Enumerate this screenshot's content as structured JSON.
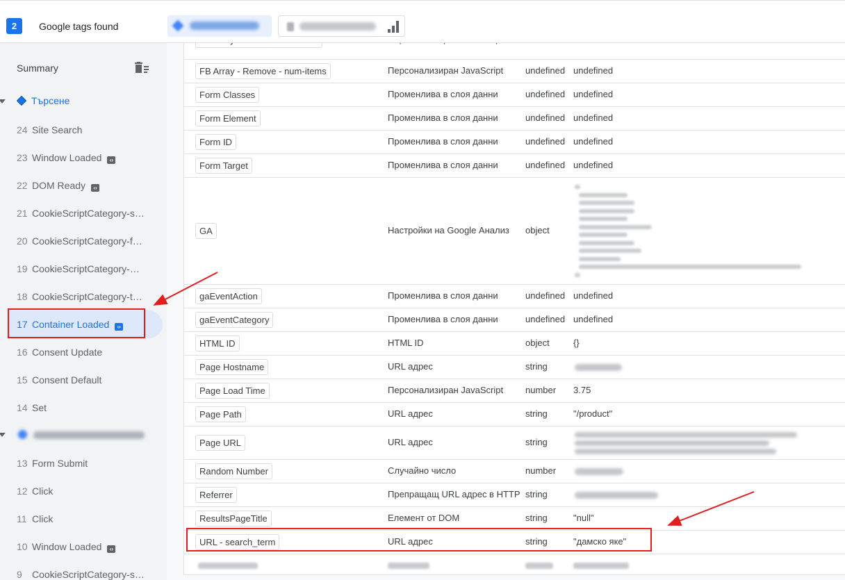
{
  "header": {
    "tag_count": "2",
    "tags_found_label": "Google tags found",
    "chip_gtm_icon": "gtm-diamond-icon",
    "chip_ga_icon": "analytics-bars-icon",
    "colors": {
      "accent": "#1a73e8",
      "analytics_orange": "#f9ab00",
      "analytics_dark": "#e37400",
      "highlight_red": "#e01e1e"
    }
  },
  "sidebar": {
    "summary_label": "Summary",
    "clear_icon": "clear-list-icon",
    "group_title": "Търсене",
    "events": [
      {
        "num": "24",
        "label": "Site Search",
        "icon": false
      },
      {
        "num": "23",
        "label": "Window Loaded",
        "icon": true
      },
      {
        "num": "22",
        "label": "DOM Ready",
        "icon": true
      },
      {
        "num": "21",
        "label": "CookieScriptCategory-s…",
        "icon": false
      },
      {
        "num": "20",
        "label": "CookieScriptCategory-f…",
        "icon": false
      },
      {
        "num": "19",
        "label": "CookieScriptCategory-…",
        "icon": false
      },
      {
        "num": "18",
        "label": "CookieScriptCategory-t…",
        "icon": false
      },
      {
        "num": "17",
        "label": "Container Loaded",
        "icon": true,
        "selected": true
      },
      {
        "num": "16",
        "label": "Consent Update",
        "icon": false
      },
      {
        "num": "15",
        "label": "Consent Default",
        "icon": false
      },
      {
        "num": "14",
        "label": "Set",
        "icon": false
      },
      {
        "num": "13",
        "label": "Form Submit",
        "icon": false
      },
      {
        "num": "12",
        "label": "Click",
        "icon": false
      },
      {
        "num": "11",
        "label": "Click",
        "icon": false
      },
      {
        "num": "10",
        "label": "Window Loaded",
        "icon": true
      },
      {
        "num": "9",
        "label": "CookieScriptCategory-s…",
        "icon": false
      }
    ]
  },
  "variables": [
    {
      "name": "FB Array - Remove - contents",
      "type": "Персонализиран JavaScript",
      "return_type": "undefined",
      "value": "undefined"
    },
    {
      "name": "FB Array - Remove - num-items",
      "type": "Персонализиран JavaScript",
      "return_type": "undefined",
      "value": "undefined"
    },
    {
      "name": "Form Classes",
      "type": "Променлива в слоя данни",
      "return_type": "undefined",
      "value": "undefined"
    },
    {
      "name": "Form Element",
      "type": "Променлива в слоя данни",
      "return_type": "undefined",
      "value": "undefined"
    },
    {
      "name": "Form ID",
      "type": "Променлива в слоя данни",
      "return_type": "undefined",
      "value": "undefined"
    },
    {
      "name": "Form Target",
      "type": "Променлива в слоя данни",
      "return_type": "undefined",
      "value": "undefined"
    },
    {
      "name": "GA",
      "type": "Настройки на Google Анализ",
      "return_type": "object",
      "value": ""
    },
    {
      "name": "gaEventAction",
      "type": "Променлива в слоя данни",
      "return_type": "undefined",
      "value": "undefined"
    },
    {
      "name": "gaEventCategory",
      "type": "Променлива в слоя данни",
      "return_type": "undefined",
      "value": "undefined"
    },
    {
      "name": "HTML ID",
      "type": "HTML ID",
      "return_type": "object",
      "value": "{}"
    },
    {
      "name": "Page Hostname",
      "type": "URL адрес",
      "return_type": "string",
      "value": ""
    },
    {
      "name": "Page Load Time",
      "type": "Персонализиран JavaScript",
      "return_type": "number",
      "value": "3.75"
    },
    {
      "name": "Page Path",
      "type": "URL адрес",
      "return_type": "string",
      "value": "\"/product\""
    },
    {
      "name": "Page URL",
      "type": "URL адрес",
      "return_type": "string",
      "value": ""
    },
    {
      "name": "Random Number",
      "type": "Случайно число",
      "return_type": "number",
      "value": ""
    },
    {
      "name": "Referrer",
      "type": "Препращащ URL адрес в HTTP",
      "return_type": "string",
      "value": ""
    },
    {
      "name": "ResultsPageTitle",
      "type": "Елемент от DOM",
      "return_type": "string",
      "value": "\"null\""
    },
    {
      "name": "URL - search_term",
      "type": "URL адрес",
      "return_type": "string",
      "value": "\"дамско яке\""
    }
  ]
}
